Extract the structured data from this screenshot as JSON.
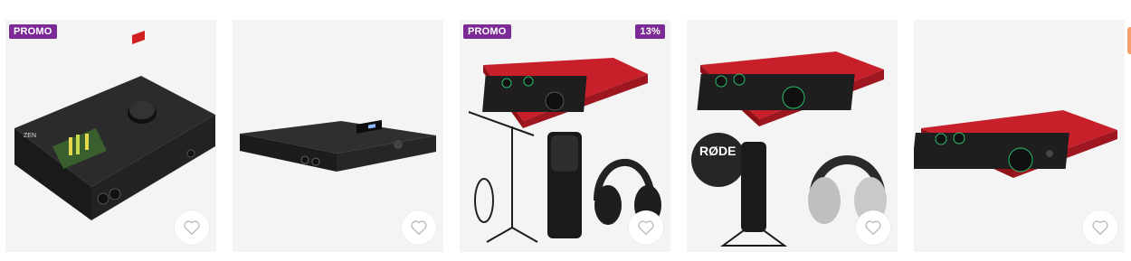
{
  "colors": {
    "promo_badge": "#7b2a96",
    "discount_badge": "#7b2a96",
    "card_background": "#f4f4f4",
    "heart_stroke": "#b9b9b9",
    "edge_accent": "#f5a06a"
  },
  "products": [
    {
      "image_icon": "audio-interface-zen-icon",
      "badges": {
        "promo": "PROMO"
      },
      "favorite_icon": "heart-icon"
    },
    {
      "image_icon": "rack-audio-interface-icon",
      "badges": {},
      "favorite_icon": "heart-icon"
    },
    {
      "image_icon": "studio-bundle-kit-icon",
      "badges": {
        "promo": "PROMO",
        "discount": "13%"
      },
      "favorite_icon": "heart-icon"
    },
    {
      "image_icon": "podcast-bundle-kit-icon",
      "badges": {},
      "favorite_icon": "heart-icon"
    },
    {
      "image_icon": "red-audio-interface-icon",
      "badges": {},
      "favorite_icon": "heart-icon"
    }
  ]
}
